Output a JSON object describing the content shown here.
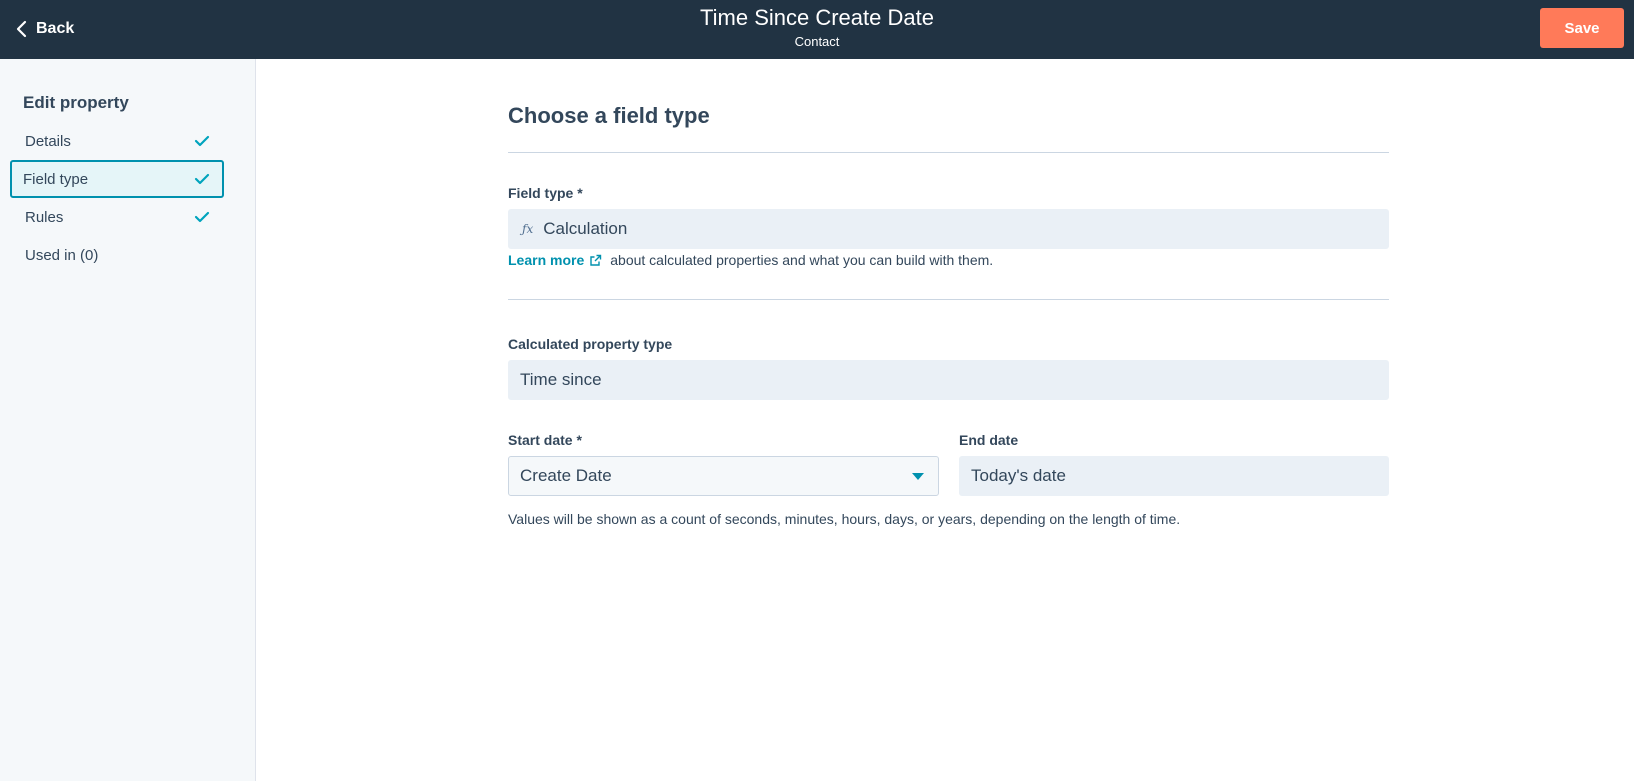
{
  "header": {
    "back_label": "Back",
    "title": "Time Since Create Date",
    "subtitle": "Contact",
    "save_label": "Save"
  },
  "sidebar": {
    "heading": "Edit property",
    "items": [
      {
        "label": "Details",
        "completed": true,
        "active": false
      },
      {
        "label": "Field type",
        "completed": true,
        "active": true
      },
      {
        "label": "Rules",
        "completed": true,
        "active": false
      },
      {
        "label": "Used in (0)",
        "completed": false,
        "active": false
      }
    ]
  },
  "main": {
    "section_title": "Choose a field type",
    "field_type": {
      "label": "Field type *",
      "icon": "function-icon",
      "icon_glyph": "ƒx",
      "value": "Calculation"
    },
    "help": {
      "link_text": "Learn more",
      "text": "about calculated properties and what you can build with them."
    },
    "calc_type": {
      "label": "Calculated property type",
      "value": "Time since"
    },
    "start_date": {
      "label": "Start date *",
      "value": "Create Date"
    },
    "end_date": {
      "label": "End date",
      "value": "Today's date"
    },
    "note": "Values will be shown as a count of seconds, minutes, hours, days, or years, depending on the length of time."
  },
  "colors": {
    "topbar": "#213343",
    "save_button": "#ff7a59",
    "accent": "#0091ae",
    "check": "#00a4bd"
  }
}
